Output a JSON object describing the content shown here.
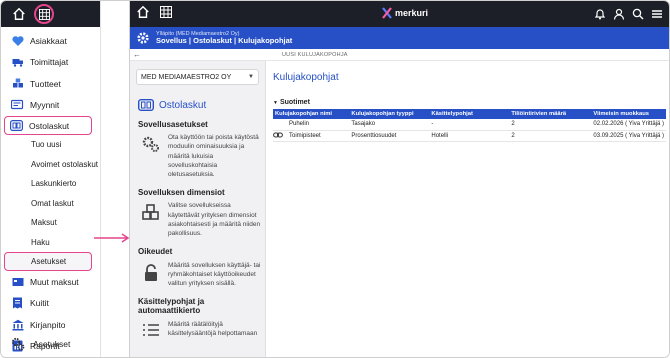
{
  "sidebar": {
    "items": [
      {
        "label": "Asiakkaat",
        "icon": "heart-icon"
      },
      {
        "label": "Toimittajat",
        "icon": "truck-icon"
      },
      {
        "label": "Tuotteet",
        "icon": "boxes-icon"
      },
      {
        "label": "Myynnit",
        "icon": "sales-icon"
      },
      {
        "label": "Ostolaskut",
        "icon": "invoice-icon"
      }
    ],
    "sub_items": [
      "Tuo uusi",
      "Avoimet ostolaskut",
      "Laskunkierto",
      "Omat laskut",
      "Maksut",
      "Haku",
      "Asetukset"
    ],
    "items2": [
      {
        "label": "Muut maksut",
        "icon": "payments-icon"
      },
      {
        "label": "Kuitit",
        "icon": "receipt-icon"
      },
      {
        "label": "Kirjanpito",
        "icon": "bank-icon"
      },
      {
        "label": "Raportit",
        "icon": "report-icon"
      }
    ],
    "bottom": "Asetukset"
  },
  "topbar": {
    "brand": "merkuri"
  },
  "header": {
    "org": "Ylläpito (MED Mediamaestro2 Oy)",
    "breadcrumb": "Sovellus | Ostolaskut | Kulujakopohjat"
  },
  "subbar": {
    "label": "UUSI KULUJAKOPOHJA"
  },
  "mid": {
    "company": "MED MEDIAMAESTRO2 OY",
    "section_title": "Ostolaskut",
    "blocks": [
      {
        "heading": "Sovellusasetukset",
        "text": "Ota käyttöön tai poista käytöstä moduulin ominaisuuksia ja määritä lukuisia sovelluskohtaisia oletusasetuksia."
      },
      {
        "heading": "Sovelluksen dimensiot",
        "text": "Valitse sovellukseissa käytettävät yrityksen dimensiot asiakohtaisesti ja määritä niiden pakollisuus."
      },
      {
        "heading": "Oikeudet",
        "text": "Määritä sovelluksen käyttäjä- tai ryhmäkohtaiset käyttöoikeudet valitun yrityksen sisällä."
      },
      {
        "heading": "Käsittelypohjat ja automaattikierto",
        "text": "Määritä räätälöityjä käsittelysääntöjä helpottamaan"
      }
    ]
  },
  "content": {
    "title": "Kulujakopohjat",
    "filter_label": "Suotimet",
    "table": {
      "headers": [
        "Kulujakopohjan nimi",
        "Kulujakopohjan tyyppi",
        "Käsittelypohjat",
        "Tiliöintirivien määrä",
        "Viimeisin muokkaus"
      ],
      "rows": [
        [
          "Puhelin",
          "Tasajako",
          "-",
          "2",
          "02.02.2026 ( Yiva Yrittäjä )"
        ],
        [
          "Toimipisteet",
          "Prosenttiosuudet",
          "Hotelli",
          "2",
          "03.09.2025 ( Yiva Yrittäjä )"
        ]
      ]
    }
  },
  "colors": {
    "accent": "#2750c6",
    "highlight": "#e4458c",
    "topbar": "#1c1f27"
  }
}
